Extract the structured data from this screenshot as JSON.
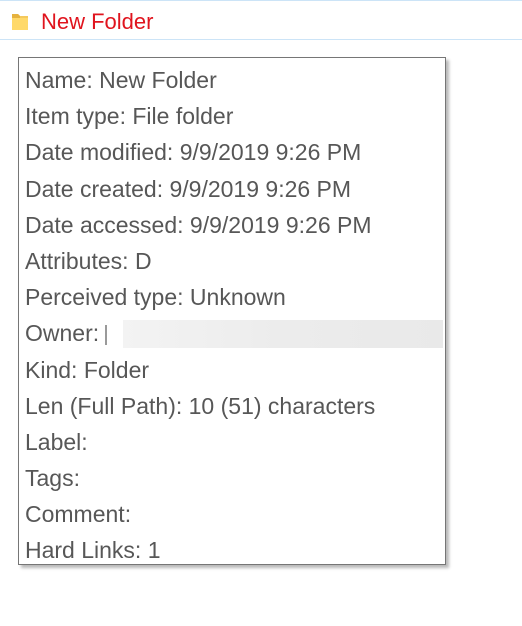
{
  "file_row": {
    "icon": "folder-icon",
    "name": "New Folder",
    "name_color": "#e0141e"
  },
  "tooltip": {
    "rows": [
      {
        "label": "Name:",
        "value": "New Folder"
      },
      {
        "label": "Item type:",
        "value": "File folder"
      },
      {
        "label": "Date modified:",
        "value": "9/9/2019 9:26 PM"
      },
      {
        "label": "Date created:",
        "value": "9/9/2019 9:26 PM"
      },
      {
        "label": "Date accessed:",
        "value": "9/9/2019 9:26 PM"
      },
      {
        "label": "Attributes:",
        "value": "D"
      },
      {
        "label": "Perceived type:",
        "value": "Unknown"
      },
      {
        "label": "Owner:",
        "value": ""
      },
      {
        "label": "Kind:",
        "value": "Folder"
      },
      {
        "label": "Len (Full Path):",
        "value": "10 (51) characters"
      },
      {
        "label": "Label:",
        "value": ""
      },
      {
        "label": "Tags:",
        "value": ""
      },
      {
        "label": "Comment:",
        "value": ""
      },
      {
        "label": "Hard Links:",
        "value": "1"
      }
    ]
  }
}
